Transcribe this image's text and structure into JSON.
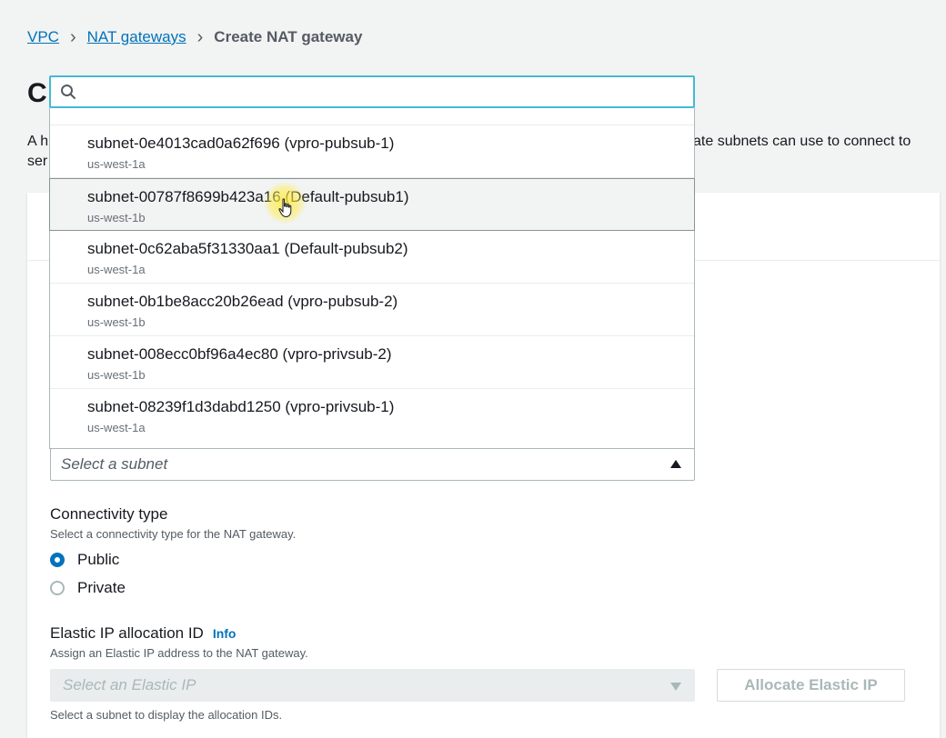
{
  "breadcrumb": {
    "vpc": "VPC",
    "nat_gateways": "NAT gateways",
    "current": "Create NAT gateway"
  },
  "page_title_visible": "C",
  "description": {
    "left_line1": "A h",
    "left_line2": "ser",
    "right_line1": "ate subnets can use to connect to"
  },
  "subnet_search": {
    "value": "",
    "icon": "search-icon"
  },
  "subnet_options": [
    {
      "label": "subnet-0e4013cad0a62f696 (vpro-pubsub-1)",
      "az": "us-west-1a"
    },
    {
      "label": "subnet-00787f8699b423a16 (Default-pubsub1)",
      "az": "us-west-1b",
      "highlighted": true
    },
    {
      "label": "subnet-0c62aba5f31330aa1 (Default-pubsub2)",
      "az": "us-west-1a"
    },
    {
      "label": "subnet-0b1be8acc20b26ead (vpro-pubsub-2)",
      "az": "us-west-1b"
    },
    {
      "label": "subnet-008ecc0bf96a4ec80 (vpro-privsub-2)",
      "az": "us-west-1b"
    },
    {
      "label": "subnet-08239f1d3dabd1250 (vpro-privsub-1)",
      "az": "us-west-1a"
    }
  ],
  "subnet_select": {
    "placeholder": "Select a subnet"
  },
  "connectivity": {
    "label": "Connectivity type",
    "help": "Select a connectivity type for the NAT gateway.",
    "options": [
      {
        "label": "Public",
        "checked": true
      },
      {
        "label": "Private",
        "checked": false
      }
    ]
  },
  "elastic_ip": {
    "label": "Elastic IP allocation ID",
    "info": "Info",
    "help": "Assign an Elastic IP address to the NAT gateway.",
    "placeholder": "Select an Elastic IP",
    "allocate_button": "Allocate Elastic IP",
    "footer": "Select a subnet to display the allocation IDs."
  },
  "colors": {
    "link": "#0073bb",
    "focus": "#44b9d6",
    "cursor_highlight": "#ffec3c"
  }
}
